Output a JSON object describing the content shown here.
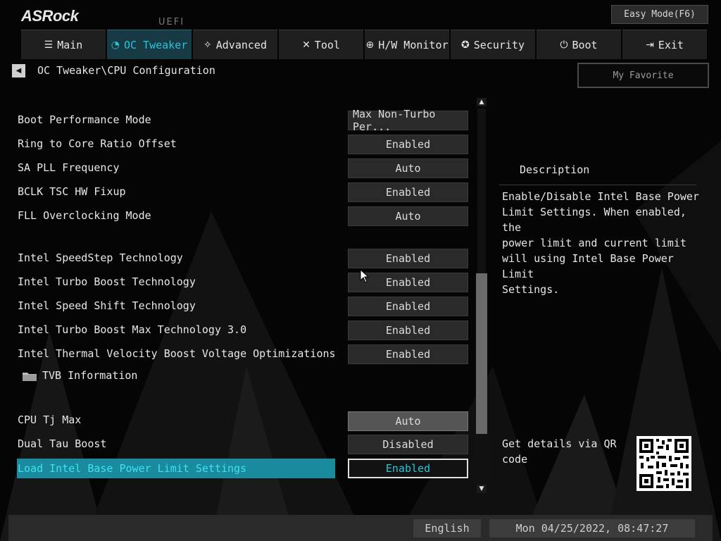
{
  "brand": {
    "logo": "ASRock",
    "uefi": "UEFI"
  },
  "easy_mode": "Easy Mode(F6)",
  "tabs": [
    {
      "label": "Main",
      "icon": "list-icon"
    },
    {
      "label": "OC Tweaker",
      "icon": "speedometer-icon",
      "active": true
    },
    {
      "label": "Advanced",
      "icon": "star-icon"
    },
    {
      "label": "Tool",
      "icon": "tools-icon"
    },
    {
      "label": "H/W Monitor",
      "icon": "monitor-icon"
    },
    {
      "label": "Security",
      "icon": "shield-icon"
    },
    {
      "label": "Boot",
      "icon": "power-icon"
    },
    {
      "label": "Exit",
      "icon": "exit-icon"
    }
  ],
  "breadcrumb": "OC Tweaker\\CPU Configuration",
  "my_favorite": "My Favorite",
  "settings": [
    {
      "label": "Boot Performance Mode",
      "value": "Max Non-Turbo Per..."
    },
    {
      "label": "Ring to Core Ratio Offset",
      "value": "Enabled"
    },
    {
      "label": "SA PLL Frequency",
      "value": "Auto"
    },
    {
      "label": "BCLK TSC HW Fixup",
      "value": "Enabled"
    },
    {
      "label": "FLL Overclocking Mode",
      "value": "Auto"
    },
    {
      "label": "Intel SpeedStep Technology",
      "value": "Enabled"
    },
    {
      "label": "Intel Turbo Boost Technology",
      "value": "Enabled"
    },
    {
      "label": "Intel Speed Shift Technology",
      "value": "Enabled"
    },
    {
      "label": "Intel Turbo Boost Max Technology 3.0",
      "value": "Enabled"
    },
    {
      "label": "Intel Thermal Velocity Boost Voltage Optimizations",
      "value": "Enabled"
    },
    {
      "label": "CPU Tj Max",
      "value": "Auto"
    },
    {
      "label": "Dual Tau Boost",
      "value": "Disabled"
    },
    {
      "label": "Load Intel Base Power Limit Settings",
      "value": "Enabled",
      "selected": true
    }
  ],
  "submenu": "TVB Information",
  "description": {
    "heading": "Description",
    "lines": [
      "Enable/Disable Intel Base Power",
      "Limit Settings. When enabled, the",
      "power limit and current limit",
      "will using Intel Base Power Limit",
      "Settings."
    ]
  },
  "qr": {
    "lines": [
      "Get details via QR",
      "code"
    ]
  },
  "footer": {
    "language": "English",
    "datetime": "Mon 04/25/2022, 08:47:27"
  },
  "colors": {
    "accent": "#26c6da",
    "selected_row": "#1a8a9e",
    "active_tab": "#173a44"
  }
}
